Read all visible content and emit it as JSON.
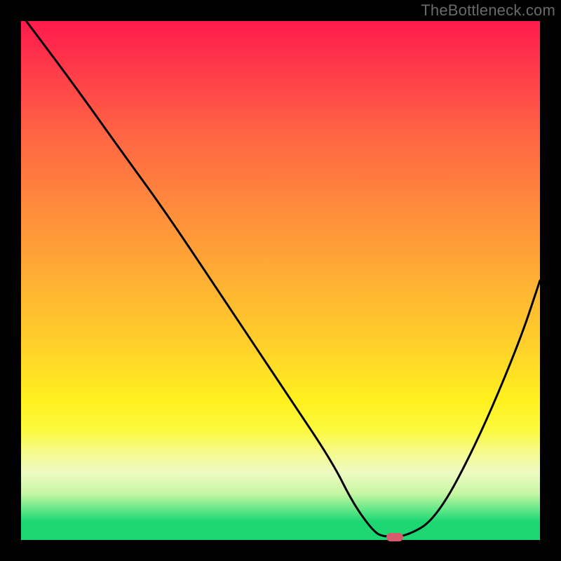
{
  "watermark": "TheBottleneck.com",
  "chart_data": {
    "type": "line",
    "title": "",
    "xlabel": "",
    "ylabel": "",
    "xlim": [
      0,
      100
    ],
    "ylim": [
      0,
      100
    ],
    "grid": false,
    "legend": false,
    "series": [
      {
        "name": "curve",
        "x": [
          1,
          10,
          20,
          28,
          40,
          52,
          60,
          64,
          68,
          70,
          74,
          80,
          88,
          96,
          100
        ],
        "values": [
          100,
          88,
          74,
          63,
          45,
          27,
          15,
          7,
          1.5,
          0.6,
          0.6,
          4,
          19,
          38,
          50
        ]
      }
    ],
    "marker": {
      "x": 72,
      "y": 0.6
    },
    "gradient_colors": {
      "top": "#ff1a4c",
      "mid": "#ffd22a",
      "bottom": "#1cd772"
    }
  }
}
